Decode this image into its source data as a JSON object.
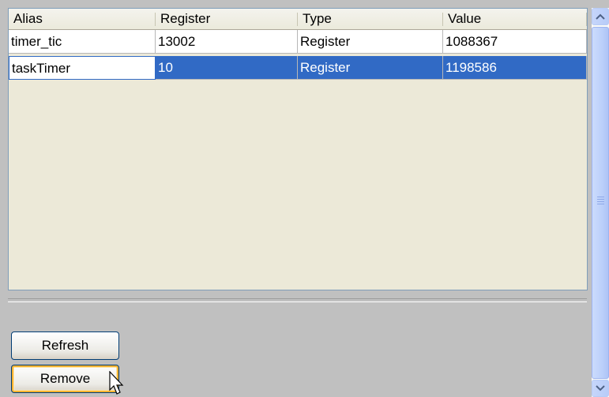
{
  "table": {
    "columns": [
      "Alias",
      "Register",
      "Type",
      "Value"
    ],
    "rows": [
      {
        "alias": "timer_tic",
        "register": "13002",
        "type": "Register",
        "value": "1088367",
        "selected": false
      },
      {
        "alias": "taskTimer",
        "register": "10",
        "type": "Register",
        "value": "1198586",
        "selected": true
      }
    ]
  },
  "buttons": {
    "refresh_label": "Refresh",
    "remove_label": "Remove"
  },
  "colors": {
    "selection": "#316ac5",
    "panel": "#c0c0c0",
    "table_bg": "#ece9d8"
  },
  "icons": [
    "scroll-up-arrow-icon",
    "scroll-down-arrow-icon",
    "mouse-pointer-icon"
  ]
}
